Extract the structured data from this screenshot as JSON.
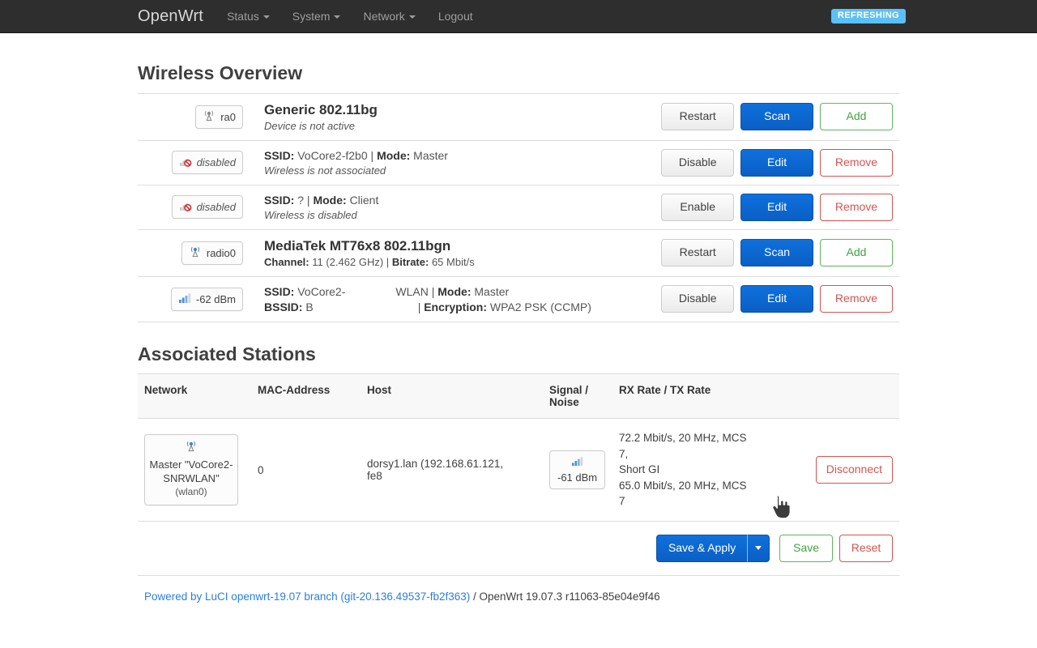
{
  "navbar": {
    "brand": "OpenWrt",
    "items": [
      {
        "label": "Status",
        "caret": true
      },
      {
        "label": "System",
        "caret": true
      },
      {
        "label": "Network",
        "caret": true
      },
      {
        "label": "Logout",
        "caret": false
      }
    ],
    "status_badge": "REFRESHING",
    "badge_color": "#5bc0f8",
    "background": "#2e2e2e"
  },
  "wireless_overview": {
    "title": "Wireless Overview",
    "rows": [
      {
        "type": "device",
        "badge_icon": "antenna-icon",
        "badge_label": "ra0",
        "badge_italic": false,
        "title": "Generic 802.11bg",
        "sub_italic": "Device is not active",
        "buttons": [
          {
            "label": "Restart",
            "style": "default"
          },
          {
            "label": "Scan",
            "style": "primary"
          },
          {
            "label": "Add",
            "style": "add"
          }
        ]
      },
      {
        "type": "iface",
        "badge_icon": "signal-disabled-icon",
        "badge_label": "disabled",
        "badge_italic": true,
        "line1_label1": "SSID:",
        "line1_value1": "VoCore2-f2b0",
        "line1_sep": "|",
        "line1_label2": "Mode:",
        "line1_value2": "Master",
        "sub_italic": "Wireless is not associated",
        "buttons": [
          {
            "label": "Disable",
            "style": "default"
          },
          {
            "label": "Edit",
            "style": "primary"
          },
          {
            "label": "Remove",
            "style": "remove"
          }
        ]
      },
      {
        "type": "iface",
        "badge_icon": "signal-disabled-icon",
        "badge_label": "disabled",
        "badge_italic": true,
        "line1_label1": "SSID:",
        "line1_value1": "?",
        "line1_sep": "|",
        "line1_label2": "Mode:",
        "line1_value2": "Client",
        "sub_italic": "Wireless is disabled",
        "buttons": [
          {
            "label": "Enable",
            "style": "default"
          },
          {
            "label": "Edit",
            "style": "primary"
          },
          {
            "label": "Remove",
            "style": "remove"
          }
        ]
      },
      {
        "type": "device",
        "badge_icon": "antenna-active-icon",
        "badge_label": "radio0",
        "badge_italic": false,
        "title": "MediaTek MT76x8 802.11bgn",
        "sub_label1": "Channel:",
        "sub_value1": "11 (2.462 GHz)",
        "sub_sep": "|",
        "sub_label2": "Bitrate:",
        "sub_value2": "65 Mbit/s",
        "buttons": [
          {
            "label": "Restart",
            "style": "default"
          },
          {
            "label": "Scan",
            "style": "primary"
          },
          {
            "label": "Add",
            "style": "add"
          }
        ]
      },
      {
        "type": "iface-signal",
        "badge_icon": "signal-bars-icon",
        "badge_label": "-62 dBm",
        "badge_italic": false,
        "ssid_label": "SSID:",
        "ssid_value_start": "VoCore2-",
        "ssid_value_end": "WLAN",
        "ssid_sep": "|",
        "mode_label": "Mode:",
        "mode_value": "Master",
        "bssid_label": "BSSID:",
        "bssid_value": "B",
        "bssid_sep": "|",
        "enc_label": "Encryption:",
        "enc_value": "WPA2 PSK (CCMP)",
        "buttons": [
          {
            "label": "Disable",
            "style": "default"
          },
          {
            "label": "Edit",
            "style": "primary"
          },
          {
            "label": "Remove",
            "style": "remove"
          }
        ]
      }
    ]
  },
  "associated_stations": {
    "title": "Associated Stations",
    "columns": [
      "Network",
      "MAC-Address",
      "Host",
      "Signal / Noise",
      "RX Rate / TX Rate",
      ""
    ],
    "signal_header_line1": "Signal /",
    "signal_header_line2": "Noise",
    "rows": [
      {
        "network_icon": "antenna-active-icon",
        "network_mode": "Master \"VoCore2-SNRWLAN\"",
        "network_iface": "(wlan0)",
        "mac": "0",
        "host_line1": "dorsy1.lan (192.168.61.121,",
        "host_line2": "fe8",
        "signal_icon": "signal-bars-icon",
        "signal": "-61 dBm",
        "rx_rate": "72.2 Mbit/s, 20 MHz, MCS 7,",
        "rx_rate_cont": "Short GI",
        "tx_rate": "65.0 Mbit/s, 20 MHz, MCS 7",
        "action": "Disconnect"
      }
    ]
  },
  "actions": {
    "save_apply": "Save & Apply",
    "dropdown_icon": "caret-down-icon",
    "save": "Save",
    "reset": "Reset"
  },
  "footer": {
    "link_text": "Powered by LuCI openwrt-19.07 branch (git-20.136.49537-fb2f363)",
    "suffix": " / OpenWrt 19.07.3 r11063-85e04e9f46"
  },
  "cursor": {
    "type": "pointing-hand-cursor"
  }
}
